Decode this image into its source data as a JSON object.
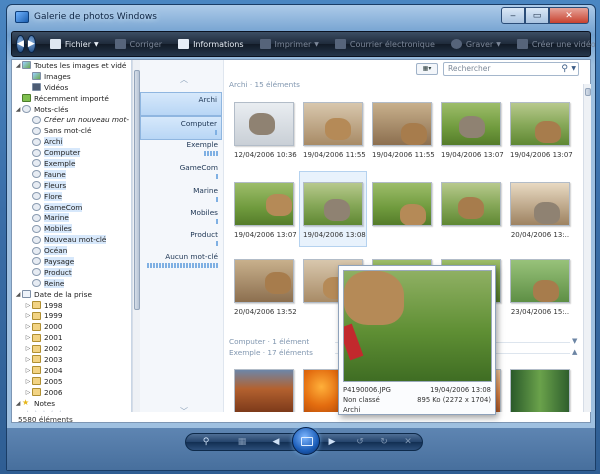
{
  "window": {
    "title": "Galerie de photos Windows"
  },
  "toolbar": {
    "items": [
      {
        "label": "Fichier",
        "enabled": true,
        "dropdown": true
      },
      {
        "label": "Corriger",
        "enabled": false
      },
      {
        "label": "Informations",
        "enabled": true
      },
      {
        "label": "Imprimer",
        "enabled": false,
        "dropdown": true
      },
      {
        "label": "Courrier électronique",
        "enabled": false
      },
      {
        "label": "Graver",
        "enabled": false,
        "dropdown": true
      },
      {
        "label": "Créer une vidéo",
        "enabled": false
      }
    ],
    "overflow": "»",
    "help": "?"
  },
  "search": {
    "placeholder": "Rechercher"
  },
  "tree": {
    "items": [
      {
        "label": "Toutes les images et vidé",
        "icon": "gallery-icon",
        "level": 0,
        "twisty": "◢"
      },
      {
        "label": "Images",
        "icon": "image-icon",
        "level": 1
      },
      {
        "label": "Vidéos",
        "icon": "video-icon",
        "level": 1
      },
      {
        "label": "Récemment importé",
        "icon": "recent-icon",
        "level": 0
      },
      {
        "label": "Mots-clés",
        "icon": "tag-icon",
        "level": 0,
        "twisty": "◢"
      },
      {
        "label": "Créer un nouveau mot-",
        "icon": "add-tag-icon",
        "level": 1,
        "italic": true
      },
      {
        "label": "Sans mot-clé",
        "icon": "tag-icon",
        "level": 1
      },
      {
        "label": "Archi",
        "icon": "tag-icon",
        "level": 1,
        "selected": true
      },
      {
        "label": "Computer",
        "icon": "tag-icon",
        "level": 1,
        "selected": true
      },
      {
        "label": "Exemple",
        "icon": "tag-icon",
        "level": 1,
        "selected": true
      },
      {
        "label": "Faune",
        "icon": "tag-icon",
        "level": 1,
        "selected": true
      },
      {
        "label": "Fleurs",
        "icon": "tag-icon",
        "level": 1,
        "selected": true
      },
      {
        "label": "Flore",
        "icon": "tag-icon",
        "level": 1,
        "selected": true
      },
      {
        "label": "GameCom",
        "icon": "tag-icon",
        "level": 1,
        "selected": true
      },
      {
        "label": "Marine",
        "icon": "tag-icon",
        "level": 1,
        "selected": true
      },
      {
        "label": "Mobiles",
        "icon": "tag-icon",
        "level": 1,
        "selected": true
      },
      {
        "label": "Nouveau mot-clé",
        "icon": "tag-icon",
        "level": 1,
        "selected": true
      },
      {
        "label": "Océan",
        "icon": "tag-icon",
        "level": 1,
        "selected": true
      },
      {
        "label": "Paysage",
        "icon": "tag-icon",
        "level": 1,
        "selected": true
      },
      {
        "label": "Product",
        "icon": "tag-icon",
        "level": 1,
        "selected": true
      },
      {
        "label": "Reine",
        "icon": "tag-icon",
        "level": 1,
        "selected": true
      },
      {
        "label": "Date de la prise",
        "icon": "calendar-icon",
        "level": 0,
        "twisty": "◢"
      },
      {
        "label": "1998",
        "icon": "folder-icon",
        "level": 1,
        "twisty": "▷"
      },
      {
        "label": "1999",
        "icon": "folder-icon",
        "level": 1,
        "twisty": "▷"
      },
      {
        "label": "2000",
        "icon": "folder-icon",
        "level": 1,
        "twisty": "▷"
      },
      {
        "label": "2001",
        "icon": "folder-icon",
        "level": 1,
        "twisty": "▷"
      },
      {
        "label": "2002",
        "icon": "folder-icon",
        "level": 1,
        "twisty": "▷"
      },
      {
        "label": "2003",
        "icon": "folder-icon",
        "level": 1,
        "twisty": "▷"
      },
      {
        "label": "2004",
        "icon": "folder-icon",
        "level": 1,
        "twisty": "▷"
      },
      {
        "label": "2005",
        "icon": "folder-icon",
        "level": 1,
        "twisty": "▷"
      },
      {
        "label": "2006",
        "icon": "folder-icon",
        "level": 1,
        "twisty": "▷"
      },
      {
        "label": "Notes",
        "icon": "star-icon",
        "level": 0,
        "twisty": "◢"
      }
    ],
    "rating_stars": "☆☆☆☆☆"
  },
  "status": {
    "count": "5580 éléments"
  },
  "filters": {
    "items": [
      {
        "label": "Archi",
        "selected": true,
        "bars": 0
      },
      {
        "label": "Computer",
        "selected": true,
        "bars": 1
      },
      {
        "label": "Exemple",
        "selected": false,
        "bars": 5
      },
      {
        "label": "GameCom",
        "selected": false,
        "bars": 1
      },
      {
        "label": "Marine",
        "selected": false,
        "bars": 1
      },
      {
        "label": "Mobiles",
        "selected": false,
        "bars": 1
      },
      {
        "label": "Product",
        "selected": false,
        "bars": 1
      },
      {
        "label": "Aucun mot-clé",
        "selected": false,
        "bars": 24
      }
    ]
  },
  "groups": [
    {
      "label": "Archi · 15 éléments"
    },
    {
      "label": "Computer · 1 élément"
    },
    {
      "label": "Exemple · 17 éléments"
    }
  ],
  "thumbnails": [
    {
      "caption": "12/04/2006 10:36",
      "scene": "snow"
    },
    {
      "caption": "19/04/2006 11:55",
      "scene": "indoor2"
    },
    {
      "caption": "19/04/2006 11:55",
      "scene": "indoor"
    },
    {
      "caption": "19/04/2006 13:07",
      "scene": "grass"
    },
    {
      "caption": "19/04/2006 13:07",
      "scene": "grass2"
    },
    {
      "caption": "19/04/2006 13:07",
      "scene": "grass"
    },
    {
      "caption": "19/04/2006 13:08",
      "scene": "grass2"
    },
    {
      "caption": "",
      "scene": "grass"
    },
    {
      "caption": "",
      "scene": "grass2"
    },
    {
      "caption": "20/04/2006 13:..",
      "scene": "room"
    },
    {
      "caption": "20/04/2006 13:52",
      "scene": "indoor"
    },
    {
      "caption": "",
      "scene": "indoor2"
    },
    {
      "caption": "",
      "scene": "grass"
    },
    {
      "caption": "",
      "scene": "grass"
    },
    {
      "caption": "23/04/2006 15:..",
      "scene": "park"
    },
    {
      "caption": "",
      "scene": "desert"
    },
    {
      "caption": "",
      "scene": "orange-fl"
    },
    {
      "caption": "",
      "scene": "red-art"
    },
    {
      "caption": "",
      "scene": "dunes"
    },
    {
      "caption": "",
      "scene": "forest"
    }
  ],
  "preview": {
    "filename": "P4190006.JPG",
    "datetime": "19/04/2006 13:08",
    "rating": "Non classé",
    "size": "895 Ko (2272 x 1704)",
    "tag": "Archi"
  },
  "bottom_controls": [
    {
      "name": "zoom-icon",
      "glyph": "⚲",
      "enabled": true
    },
    {
      "name": "fit-window-icon",
      "glyph": "▦",
      "enabled": false
    },
    {
      "name": "previous-icon",
      "glyph": "◀",
      "enabled": true
    },
    {
      "name": "slideshow-icon",
      "glyph": "",
      "enabled": true
    },
    {
      "name": "next-icon",
      "glyph": "▶",
      "enabled": true
    },
    {
      "name": "rotate-left-icon",
      "glyph": "↺",
      "enabled": false
    },
    {
      "name": "rotate-right-icon",
      "glyph": "↻",
      "enabled": false
    },
    {
      "name": "delete-icon",
      "glyph": "✕",
      "enabled": false
    }
  ]
}
